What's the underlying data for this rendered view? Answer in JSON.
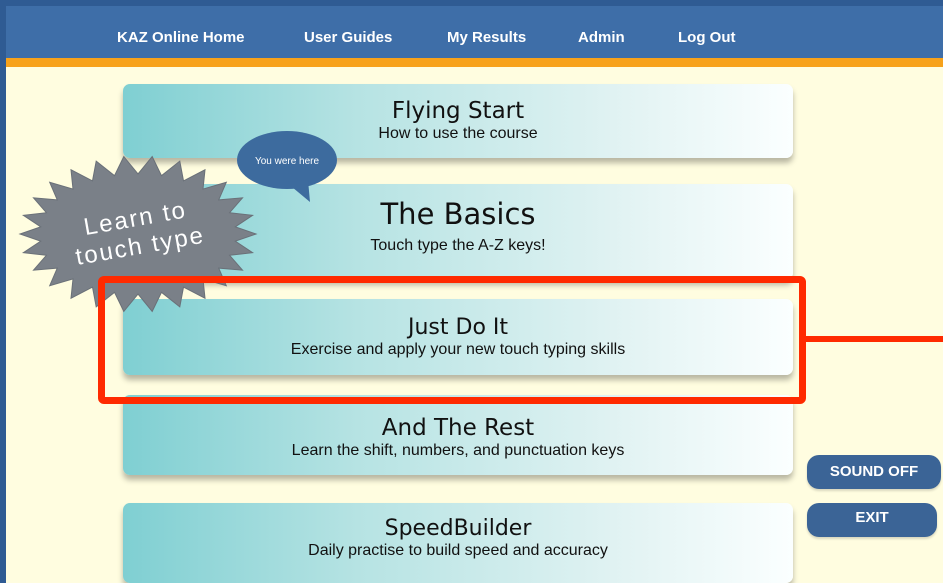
{
  "nav": {
    "home": "KAZ Online Home",
    "guides": "User Guides",
    "results": "My Results",
    "admin": "Admin",
    "logout": "Log Out"
  },
  "badge": {
    "line1": "Learn to",
    "line2": "touch type"
  },
  "bubble": {
    "text": "You were here"
  },
  "cards": [
    {
      "title": "Flying Start",
      "subtitle": "How to use the course"
    },
    {
      "title": "The Basics",
      "subtitle": "Touch type the A-Z keys!"
    },
    {
      "title": "Just Do It",
      "subtitle": "Exercise and apply your new touch typing skills"
    },
    {
      "title": "And The Rest",
      "subtitle": "Learn the shift, numbers, and punctuation keys"
    },
    {
      "title": "SpeedBuilder",
      "subtitle": "Daily practise to build speed and accuracy"
    }
  ],
  "buttons": {
    "sound": "SOUND OFF",
    "exit": "EXIT"
  },
  "colors": {
    "navbar": "#3e6ea8",
    "orange_bar": "#f7a21b",
    "background": "#fffde0",
    "highlight": "#ff2a00",
    "button": "#3b6496"
  }
}
